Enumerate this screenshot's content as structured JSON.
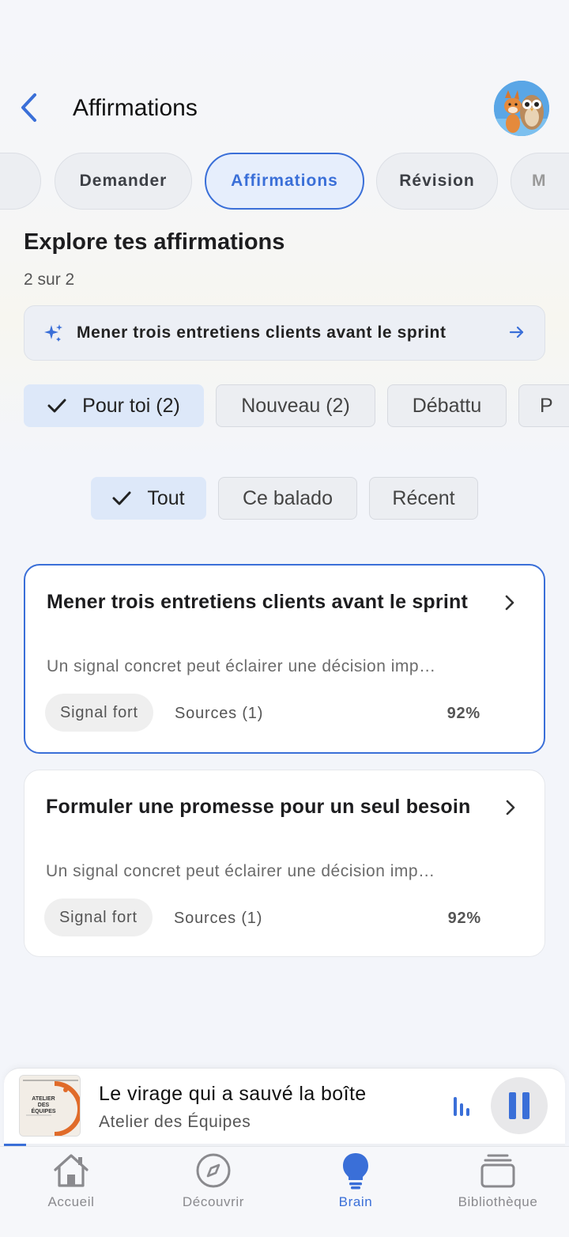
{
  "header": {
    "title": "Affirmations"
  },
  "tabs": [
    {
      "label": "",
      "partial": true
    },
    {
      "label": "Demander"
    },
    {
      "label": "Affirmations",
      "active": true
    },
    {
      "label": "Révision"
    },
    {
      "label": "M",
      "partial": true
    }
  ],
  "section": {
    "title": "Explore tes affirmations",
    "count": "2 sur 2"
  },
  "suggestion": {
    "text": "Mener trois entretiens clients avant le sprint"
  },
  "filters": [
    {
      "label": "Pour toi (2)",
      "active": true
    },
    {
      "label": "Nouveau (2)"
    },
    {
      "label": "Débattu"
    },
    {
      "label": "P"
    }
  ],
  "scope_filters": [
    {
      "label": "Tout",
      "active": true
    },
    {
      "label": "Ce balado"
    },
    {
      "label": "Récent"
    }
  ],
  "cards": [
    {
      "title": "Mener trois entretiens clients avant le sprint",
      "description": "Un signal concret peut éclairer une décision imp…",
      "badge": "Signal fort",
      "sources": "Sources (1)",
      "percent": "92%",
      "selected": true
    },
    {
      "title": "Formuler une promesse pour un seul besoin",
      "description": "Un signal concret peut éclairer une décision imp…",
      "badge": "Signal fort",
      "sources": "Sources (1)",
      "percent": "92%",
      "selected": false
    }
  ],
  "player": {
    "title": "Le virage qui a sauvé la boîte",
    "subtitle": "Atelier des Équipes",
    "cover_text": "ATELIER DES ÉQUIPES",
    "progress": 0.04
  },
  "tabbar": [
    {
      "label": "Accueil",
      "icon": "home-icon"
    },
    {
      "label": "Découvrir",
      "icon": "compass-icon"
    },
    {
      "label": "Brain",
      "icon": "lightbulb-icon",
      "active": true
    },
    {
      "label": "Bibliothèque",
      "icon": "library-icon"
    }
  ],
  "colors": {
    "accent": "#3a6fd8",
    "background": "#f3f5fa",
    "chip_active": "#dde8f9"
  }
}
